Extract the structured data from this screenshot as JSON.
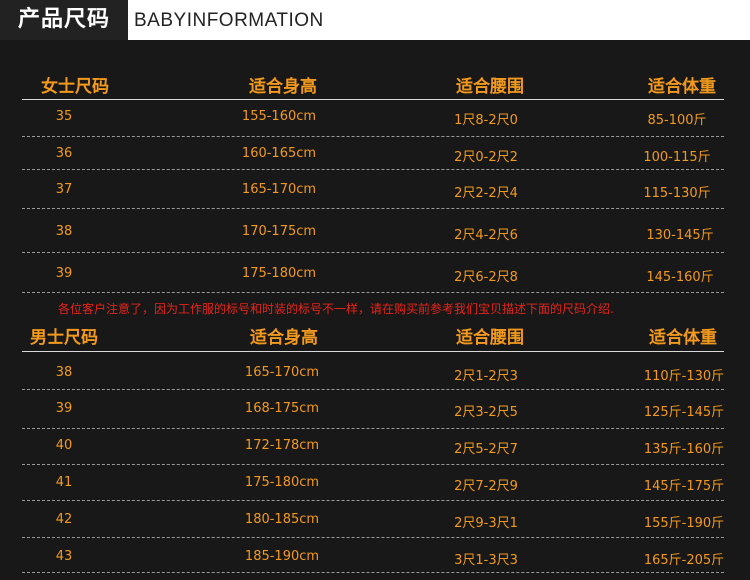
{
  "header": {
    "title_cn": "产品尺码",
    "title_en": "BABYINFORMATION"
  },
  "women": {
    "columns": [
      "女士尺码",
      "适合身高",
      "适合腰围",
      "适合体重"
    ],
    "rows": [
      [
        "35",
        "155-160cm",
        "1尺8-2尺0",
        "85-100斤"
      ],
      [
        "36",
        "160-165cm",
        "2尺0-2尺2",
        "100-115斤"
      ],
      [
        "37",
        "165-170cm",
        "2尺2-2尺4",
        "115-130斤"
      ],
      [
        "38",
        "170-175cm",
        "2尺4-2尺6",
        "130-145斤"
      ],
      [
        "39",
        "175-180cm",
        "2尺6-2尺8",
        "145-160斤"
      ]
    ]
  },
  "notice": "各位客户注意了，因为工作服的标号和时装的标号不一样，请在购买前参考我们宝贝描述下面的尺码介绍.",
  "men": {
    "columns": [
      "男士尺码",
      "适合身高",
      "适合腰围",
      "适合体重"
    ],
    "rows": [
      [
        "38",
        "165-170cm",
        "2尺1-2尺3",
        "110斤-130斤"
      ],
      [
        "39",
        "168-175cm",
        "2尺3-2尺5",
        "125斤-145斤"
      ],
      [
        "40",
        "172-178cm",
        "2尺5-2尺7",
        "135斤-160斤"
      ],
      [
        "41",
        "175-180cm",
        "2尺7-2尺9",
        "145斤-175斤"
      ],
      [
        "42",
        "180-185cm",
        "2尺9-3尺1",
        "155斤-190斤"
      ],
      [
        "43",
        "185-190cm",
        "3尺1-3尺3",
        "165斤-205斤"
      ]
    ]
  }
}
